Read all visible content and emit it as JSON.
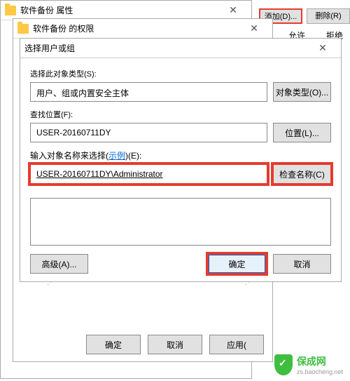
{
  "dlg1": {
    "title": "软件备份 属性"
  },
  "dlg2": {
    "title": "软件备份 的权限",
    "perm_allow": "允许",
    "perm_deny": "拒绝"
  },
  "toolbar": {
    "add": "添加(D)...",
    "remove": "删除(R)"
  },
  "dlg3": {
    "title": "选择用户或组",
    "type_label": "选择此对象类型(S):",
    "type_value": "用户、组或内置安全主体",
    "type_btn": "对象类型(O)...",
    "loc_label": "查找位置(F):",
    "loc_value": "USER-20160711DY",
    "loc_btn": "位置(L)...",
    "names_label_prefix": "输入对象名称来选择(",
    "names_label_link": "示例",
    "names_label_suffix": ")(E):",
    "names_value": "USER-20160711DY\\Administrator",
    "check_btn": "检查名称(C)",
    "adv_btn": "高级(A)...",
    "ok": "确定",
    "cancel": "取消"
  },
  "bottombar": {
    "ok": "确定",
    "cancel": "取消",
    "apply": "应用("
  },
  "watermark": {
    "name": "保成网",
    "url": "zs.baocheng.net"
  }
}
